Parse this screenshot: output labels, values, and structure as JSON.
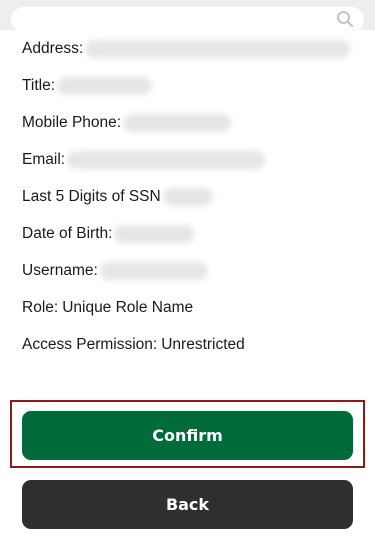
{
  "search": {
    "icon": "search-icon",
    "value": ""
  },
  "fields": [
    {
      "label": "Address:",
      "value": null,
      "redacted": true
    },
    {
      "label": "Title:",
      "value": null,
      "redacted": true
    },
    {
      "label": "Mobile Phone:",
      "value": null,
      "redacted": true
    },
    {
      "label": "Email:",
      "value": null,
      "redacted": true
    },
    {
      "label": "Last 5 Digits of SSN",
      "value": null,
      "redacted": true
    },
    {
      "label": "Date of Birth:",
      "value": null,
      "redacted": true
    },
    {
      "label": "Username:",
      "value": null,
      "redacted": true
    },
    {
      "label": "Role:",
      "value": "Unique Role Name",
      "redacted": false
    },
    {
      "label": "Access Permission:",
      "value": "Unrestricted",
      "redacted": false
    }
  ],
  "actions": {
    "confirm_label": "Confirm",
    "back_label": "Back"
  },
  "colors": {
    "confirm_bg": "#006b3a",
    "back_bg": "#2f2f2f",
    "highlight_border": "#8b1a1a"
  }
}
